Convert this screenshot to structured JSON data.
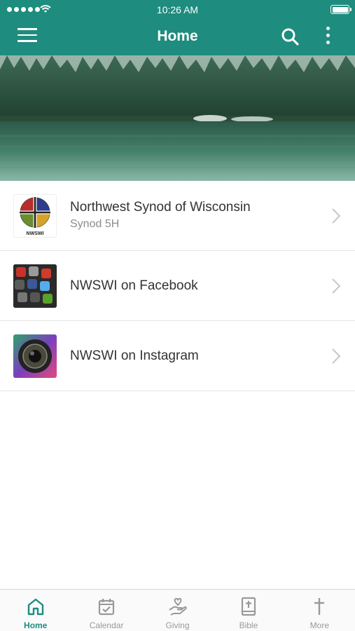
{
  "status_bar": {
    "time": "10:26 AM"
  },
  "header": {
    "title": "Home",
    "menu_icon": "hamburger-menu-icon",
    "search_icon": "search-icon",
    "more_icon": "vertical-dots-icon"
  },
  "colors": {
    "accent": "#1e8c7e",
    "inactive": "#999999"
  },
  "list": [
    {
      "title": "Northwest Synod of Wisconsin",
      "subtitle": "Synod 5H",
      "logo_text": "NWSWI",
      "thumb_icon": "synod-cross-logo-icon"
    },
    {
      "title": "NWSWI on Facebook",
      "thumb_icon": "social-media-apps-icon"
    },
    {
      "title": "NWSWI on Instagram",
      "thumb_icon": "camera-lens-icon"
    }
  ],
  "tabs": [
    {
      "label": "Home",
      "icon": "home-icon",
      "active": true
    },
    {
      "label": "Calendar",
      "icon": "calendar-icon",
      "active": false
    },
    {
      "label": "Giving",
      "icon": "giving-hand-heart-icon",
      "active": false
    },
    {
      "label": "Bible",
      "icon": "bible-icon",
      "active": false
    },
    {
      "label": "More",
      "icon": "cross-icon",
      "active": false
    }
  ]
}
